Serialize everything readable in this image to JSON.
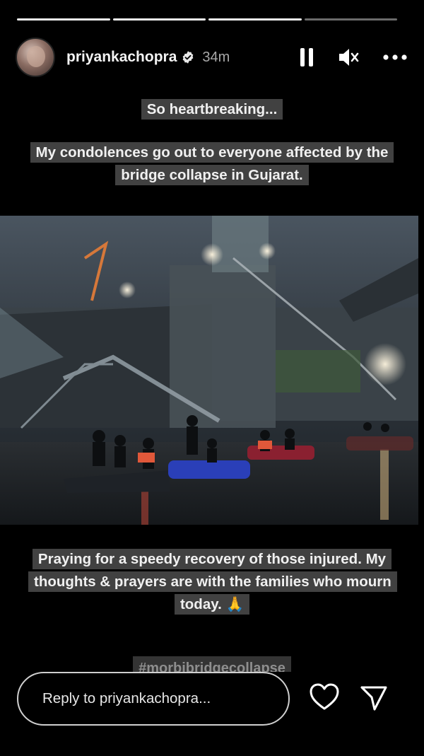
{
  "progress": {
    "segments": 4,
    "active_index": 3
  },
  "header": {
    "username": "priyankachopra",
    "time": "34m",
    "icons": [
      "avatar",
      "verified-badge-icon",
      "pause-icon",
      "muted-speaker-icon",
      "more-options-icon"
    ]
  },
  "captions": {
    "line1": "So heartbreaking...",
    "line2": "My condolences go out to everyone  affected by the bridge collapse in Gujarat.",
    "line3": "Praying for a speedy recovery of those injured. My thoughts & prayers are with the families who mourn today. 🙏"
  },
  "hashtag": "#morbibridgecollapse",
  "reply": {
    "placeholder": "Reply to priyankachopra..."
  },
  "colors": {
    "background": "#000000",
    "caption_bg": "#464646",
    "text": "#f0f0f0",
    "secondary_text": "#a8a8a8"
  }
}
